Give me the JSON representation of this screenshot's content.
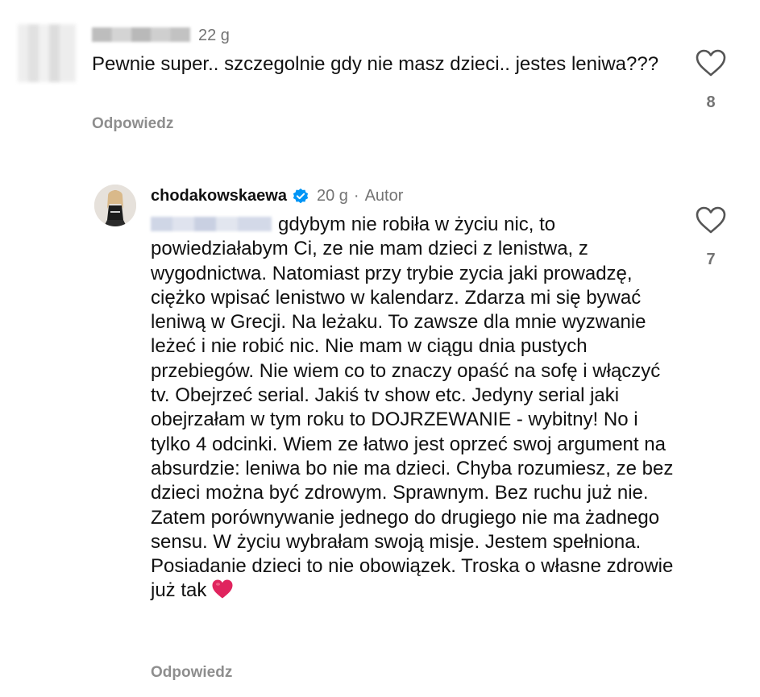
{
  "comments": [
    {
      "username_hidden": true,
      "time": "22 g",
      "text": "Pewnie super.. szczegolnie gdy nie masz dzieci.. jestes leniwa???",
      "reply_label": "Odpowiedz",
      "likes": "8"
    },
    {
      "username": "chodakowskaewa",
      "verified": true,
      "time": "20 g",
      "separator": "·",
      "author_label": "Autor",
      "mention_hidden": true,
      "text": "gdybym nie robiła w życiu nic, to powiedziałabym Ci, ze nie mam dzieci z lenistwa, z wygodnictwa. Natomiast przy trybie zycia jaki prowadzę, ciężko wpisać lenistwo w kalendarz. Zdarza mi się bywać leniwą w Grecji. Na leżaku. To zawsze dla mnie wyzwanie leżeć i nie robić nic. Nie mam w ciągu dnia pustych przebiegów. Nie wiem co to znaczy opaść na sofę i włączyć tv. Obejrzeć serial. Jakiś tv show etc. Jedyny serial jaki obejrzałam w tym roku to DOJRZEWANIE - wybitny! No i tylko 4 odcinki. Wiem ze łatwo jest oprzeć swoj argument na absurdzie: leniwa bo nie ma dzieci. Chyba rozumiesz, ze bez dzieci można być zdrowym. Sprawnym. Bez ruchu już nie. Zatem porównywanie jednego do drugiego nie ma żadnego sensu. W życiu wybrałam swoją misje. Jestem spełniona. Posiadanie dzieci to nie obowiązek. Troska o własne zdrowie już tak",
      "emoji": "red-heart",
      "reply_label": "Odpowiedz",
      "likes": "7"
    }
  ],
  "icons": {
    "like": "heart-outline-icon",
    "verified": "verified-badge-icon"
  },
  "colors": {
    "text": "#111111",
    "secondary": "#737373",
    "reply": "#8e8e8e",
    "verified": "#0095f6",
    "heart_emoji": "#e0245e"
  }
}
